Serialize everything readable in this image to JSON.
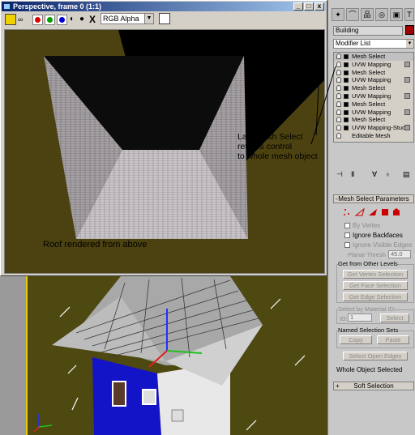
{
  "window": {
    "title": "Perspective, frame 0 (1:1)",
    "minimize": "_",
    "maximize": "□",
    "close": "x"
  },
  "toolbar": {
    "channel": "RGB Alpha",
    "clear_label": "X"
  },
  "render": {
    "annotation_stack": "Last Mesh Select\nreturns control\nto whole mesh object",
    "annotation_roof": "Roof rendered from above"
  },
  "panel": {
    "object_name": "Building",
    "modifier_list": "Modifier List",
    "name_color": "#a00000",
    "stack": [
      {
        "label": "Mesh Select",
        "selected": true
      },
      {
        "label": "UVW Mapping"
      },
      {
        "label": "Mesh Select"
      },
      {
        "label": "UVW Mapping"
      },
      {
        "label": "Mesh Select"
      },
      {
        "label": "UVW Mapping"
      },
      {
        "label": "Mesh Select"
      },
      {
        "label": "UVW Mapping"
      },
      {
        "label": "Mesh Select"
      },
      {
        "label": "UVW Mapping-Stuc"
      },
      {
        "label": "Editable Mesh"
      }
    ]
  },
  "params": {
    "title": "Mesh Select Parameters",
    "by_vertex": "By Vertex",
    "ignore_backfaces": "Ignore Backfaces",
    "ignore_visible_edges": "Ignore Visible Edges",
    "planar_thresh_label": "Planar Thresh",
    "planar_thresh_value": "45.0",
    "get_from_other": "Get from Other Levels",
    "get_vertex": "Get Vertex Selection",
    "get_face": "Get Face Selection",
    "get_edge": "Get Edge Selection",
    "select_by_mat": "Select by Material ID",
    "id_label": "ID:",
    "id_value": "1",
    "select_btn": "Select",
    "named_sets": "Named Selection Sets",
    "copy": "Copy",
    "paste": "Paste",
    "select_open_edges": "Select Open Edges",
    "status": "Whole Object Selected",
    "soft_selection": "Soft Selection",
    "collapse": "-",
    "expand": "+"
  }
}
